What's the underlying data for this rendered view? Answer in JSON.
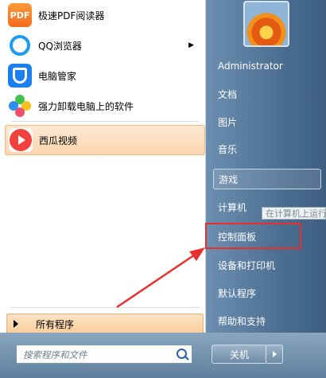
{
  "programs": [
    {
      "label": "极速PDF阅读器",
      "icon": "pdf-reader-icon",
      "icon_text": "PDF"
    },
    {
      "label": "QQ浏览器",
      "icon": "qq-browser-icon"
    },
    {
      "label": "电脑管家",
      "icon": "pc-manager-shield-icon"
    },
    {
      "label": "强力卸载电脑上的软件",
      "icon": "uninstall-flower-icon"
    },
    {
      "label": "西瓜视频",
      "icon": "xigua-video-play-icon"
    }
  ],
  "all_programs_label": "所有程序",
  "search": {
    "placeholder": "搜索程序和文件"
  },
  "user": {
    "name": "Administrator"
  },
  "right_items": {
    "documents": "文档",
    "pictures": "图片",
    "music": "音乐",
    "games": "游戏",
    "computer": "计算机",
    "control_panel": "控制面板",
    "devices_printers": "设备和打印机",
    "default_programs": "默认程序",
    "help_support": "帮助和支持"
  },
  "tooltip": "在计算机上运行",
  "shutdown_label": "关机",
  "colors": {
    "highlight_box": "#e63030",
    "arrow": "#e63030",
    "selected_item": "#fbd6b0"
  }
}
